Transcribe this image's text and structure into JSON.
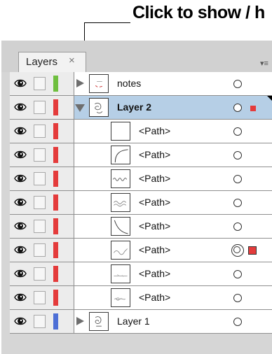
{
  "callout": {
    "text": "Click to show / h"
  },
  "panel": {
    "tab_label": "Layers",
    "tab_close": "×",
    "menu_icon": "▾≡"
  },
  "colors": {
    "notes": "#6fbf3f",
    "layer2": "#e43b3b",
    "layer1": "#4d6fd6",
    "selected_row": "#b6cfe6"
  },
  "rows": [
    {
      "name": "notes",
      "type": "layer",
      "expanded": false,
      "bold": false,
      "color": "#6fbf3f"
    },
    {
      "name": "Layer 2",
      "type": "layer",
      "expanded": true,
      "bold": true,
      "selected": true,
      "color": "#e43b3b"
    },
    {
      "name": "<Path>",
      "type": "path"
    },
    {
      "name": "<Path>",
      "type": "path"
    },
    {
      "name": "<Path>",
      "type": "path"
    },
    {
      "name": "<Path>",
      "type": "path"
    },
    {
      "name": "<Path>",
      "type": "path"
    },
    {
      "name": "<Path>",
      "type": "path",
      "targeted": true
    },
    {
      "name": "<Path>",
      "type": "path"
    },
    {
      "name": "<Path>",
      "type": "path"
    },
    {
      "name": "Layer 1",
      "type": "layer",
      "expanded": false,
      "bold": false,
      "color": "#4d6fd6"
    }
  ],
  "icons": {
    "visibility": "eye-icon",
    "lock": "lock-toggle",
    "expand": "triangle-icon",
    "target": "target-circle-icon"
  }
}
